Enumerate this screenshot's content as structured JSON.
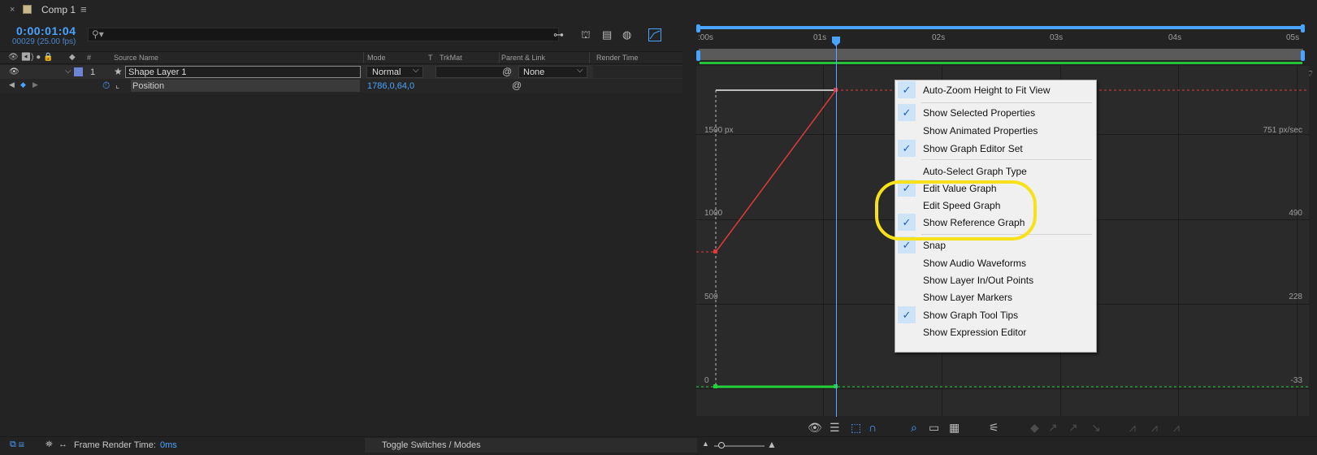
{
  "tab": {
    "close": "×",
    "title": "Comp 1",
    "menu": "≡"
  },
  "timecode": "0:00:01:04",
  "frame_info": "00029 (25.00 fps)",
  "search": {
    "placeholder": "",
    "icon": "search-icon"
  },
  "columns": {
    "source_name": "Source Name",
    "mode": "Mode",
    "t": "T",
    "trkmat": "TrkMat",
    "parent_link": "Parent & Link",
    "render_time": "Render Time",
    "num": "#"
  },
  "layer": {
    "number": "1",
    "name": "Shape Layer 1",
    "mode": "Normal",
    "parent": "None",
    "label_color": "#6d84d6"
  },
  "property": {
    "name": "Position",
    "value": "1786,0,64,0"
  },
  "ruler": {
    "ticks": [
      ":00s",
      "01s",
      "02s",
      "03s",
      "04s",
      "05s"
    ]
  },
  "graph": {
    "left_labels": [
      "1500 px",
      "1000",
      "500",
      "0"
    ],
    "right_labels": [
      "751 px/sec",
      "490",
      "228",
      "-33"
    ],
    "current_time_s": 1.16,
    "keyframe_values": [
      {
        "t": 0,
        "value": 880
      },
      {
        "t": 1.16,
        "value": 1786
      }
    ]
  },
  "menu": {
    "groups": [
      [
        {
          "label": "Auto-Zoom Height to Fit View",
          "checked": true
        }
      ],
      [
        {
          "label": "Show Selected Properties",
          "checked": true
        },
        {
          "label": "Show Animated Properties",
          "checked": false
        },
        {
          "label": "Show Graph Editor Set",
          "checked": true
        }
      ],
      [
        {
          "label": "Auto-Select Graph Type",
          "checked": false
        },
        {
          "label": "Edit Value Graph",
          "checked": true
        },
        {
          "label": "Edit Speed Graph",
          "checked": false
        },
        {
          "label": "Show Reference Graph",
          "checked": true
        }
      ],
      [
        {
          "label": "Snap",
          "checked": true
        },
        {
          "label": "Show Audio Waveforms",
          "checked": false
        },
        {
          "label": "Show Layer In/Out Points",
          "checked": false
        },
        {
          "label": "Show Layer Markers",
          "checked": false
        },
        {
          "label": "Show Graph Tool Tips",
          "checked": true
        },
        {
          "label": "Show Expression Editor",
          "checked": false
        }
      ]
    ]
  },
  "status": {
    "frame_render_label": "Frame Render Time:",
    "frame_render_value": "0ms",
    "toggle": "Toggle Switches / Modes"
  },
  "colors": {
    "accent_blue": "#4aa3ff",
    "value_curve": "#e03a3a",
    "speed_curve": "#23d23a",
    "highlight": "#f7e219"
  }
}
